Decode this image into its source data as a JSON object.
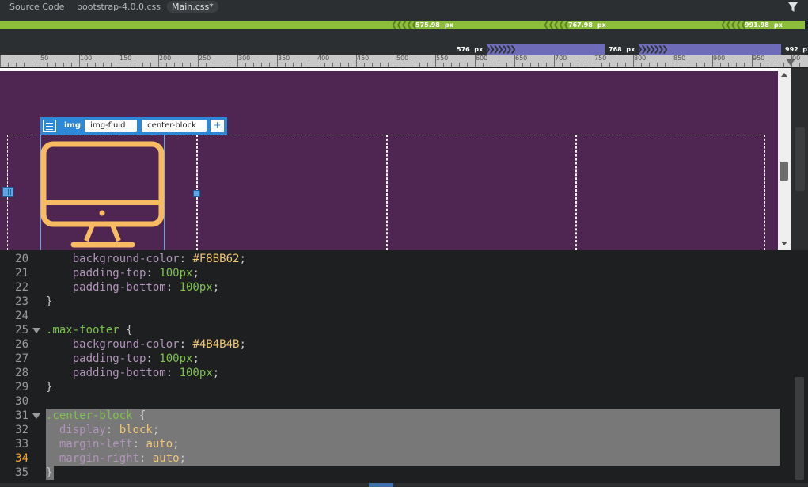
{
  "tabs": [
    {
      "label": "Source Code",
      "active": false
    },
    {
      "label": "bootstrap-4.0.0.css",
      "active": false
    },
    {
      "label": "Main.css*",
      "active": true
    }
  ],
  "media_queries": {
    "green": [
      {
        "value": "575.98",
        "unit": "px"
      },
      {
        "value": "767.98",
        "unit": "px"
      },
      {
        "value": "991.98",
        "unit": "px"
      }
    ],
    "purple": [
      {
        "value": "576",
        "unit": "px"
      },
      {
        "value": "768",
        "unit": "px"
      },
      {
        "value": "992",
        "unit": "p"
      }
    ],
    "colors": {
      "green": "#8cbd3a",
      "purple": "#6e6bb8"
    }
  },
  "ruler": {
    "labels": [
      "50",
      "100",
      "150",
      "200",
      "250",
      "300",
      "350",
      "400",
      "450",
      "500",
      "550",
      "600",
      "650",
      "700",
      "750",
      "800",
      "850",
      "900",
      "950",
      "00"
    ]
  },
  "element_hud": {
    "tag": "img",
    "classes": [
      ".img-fluid",
      ".center-block"
    ],
    "add_label": "+"
  },
  "live_view": {
    "background_color": "#4f2552",
    "icon_color": "#f8bb62",
    "icon": "monitor-icon"
  },
  "code_lines": [
    {
      "n": "20",
      "tokens": [
        [
          "prop",
          "    background-color"
        ],
        [
          "punc",
          ": "
        ],
        [
          "hex",
          "#F8BB62"
        ],
        [
          "punc",
          ";"
        ]
      ]
    },
    {
      "n": "21",
      "tokens": [
        [
          "prop",
          "    padding-top"
        ],
        [
          "punc",
          ": "
        ],
        [
          "num",
          "100px"
        ],
        [
          "punc",
          ";"
        ]
      ]
    },
    {
      "n": "22",
      "tokens": [
        [
          "prop",
          "    padding-bottom"
        ],
        [
          "punc",
          ": "
        ],
        [
          "num",
          "100px"
        ],
        [
          "punc",
          ";"
        ]
      ]
    },
    {
      "n": "23",
      "tokens": [
        [
          "punc",
          "}"
        ]
      ]
    },
    {
      "n": "24",
      "tokens": []
    },
    {
      "n": "25",
      "fold": true,
      "tokens": [
        [
          "sel-text",
          ".max-footer"
        ],
        [
          "punc",
          " {"
        ]
      ]
    },
    {
      "n": "26",
      "tokens": [
        [
          "prop",
          "    background-color"
        ],
        [
          "punc",
          ": "
        ],
        [
          "hex",
          "#4B4B4B"
        ],
        [
          "punc",
          ";"
        ]
      ]
    },
    {
      "n": "27",
      "tokens": [
        [
          "prop",
          "    padding-top"
        ],
        [
          "punc",
          ": "
        ],
        [
          "num",
          "100px"
        ],
        [
          "punc",
          ";"
        ]
      ]
    },
    {
      "n": "28",
      "tokens": [
        [
          "prop",
          "    padding-bottom"
        ],
        [
          "punc",
          ": "
        ],
        [
          "num",
          "100px"
        ],
        [
          "punc",
          ";"
        ]
      ]
    },
    {
      "n": "29",
      "tokens": [
        [
          "punc",
          "}"
        ]
      ]
    },
    {
      "n": "30",
      "tokens": []
    },
    {
      "n": "31",
      "fold": true,
      "tokens": [
        [
          "sel-text",
          ".center-block"
        ],
        [
          "punc",
          " {"
        ]
      ]
    },
    {
      "n": "32",
      "tokens": [
        [
          "prop",
          "  display"
        ],
        [
          "punc",
          ": "
        ],
        [
          "kw",
          "block"
        ],
        [
          "punc",
          ";"
        ]
      ]
    },
    {
      "n": "33",
      "tokens": [
        [
          "prop",
          "  margin-left"
        ],
        [
          "punc",
          ": "
        ],
        [
          "kw",
          "auto"
        ],
        [
          "punc",
          ";"
        ]
      ]
    },
    {
      "n": "34",
      "current": true,
      "tokens": [
        [
          "prop",
          "  margin-right"
        ],
        [
          "punc",
          ": "
        ],
        [
          "kw",
          "auto"
        ],
        [
          "punc",
          ";"
        ]
      ]
    },
    {
      "n": "35",
      "tokens": [
        [
          "punc",
          "}"
        ]
      ]
    }
  ]
}
